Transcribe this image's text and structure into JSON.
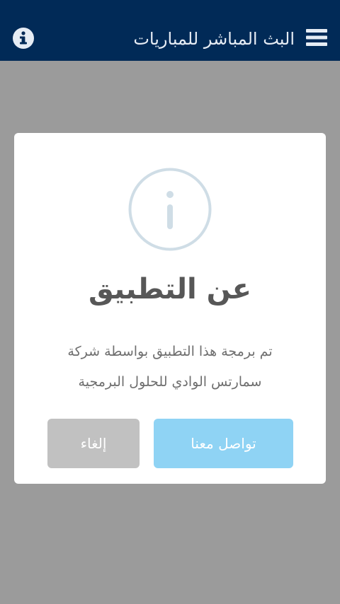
{
  "header": {
    "title": "البث المباشر للمباريات",
    "menu_icon": "hamburger-menu-icon",
    "info_icon": "info-circle-icon",
    "background": "#012a57"
  },
  "dialog": {
    "icon": "info-outline-icon",
    "title": "عن التطبيق",
    "text_line_1": "تم برمجة هذا التطبيق بواسطة شركة",
    "text_line_2": "سمارتس الوادي للحلول البرمجية",
    "confirm_label": "تواصل معنا",
    "cancel_label": "إلغاء",
    "confirm_color": "#8fd3f4",
    "cancel_color": "#c1c1c1"
  }
}
